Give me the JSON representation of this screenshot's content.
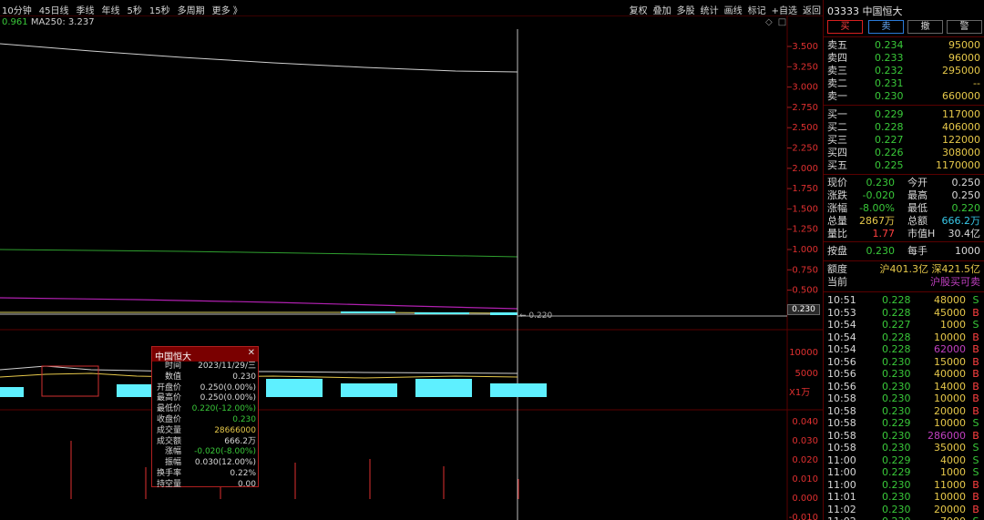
{
  "toolbar": {
    "left": [
      "10分钟",
      "45日线",
      "季线",
      "年线",
      "5秒",
      "15秒",
      "多周期",
      "更多 》"
    ],
    "right": [
      "复权",
      "叠加",
      "多股",
      "统计",
      "画线",
      "标记",
      "+自选",
      "返回"
    ]
  },
  "ma": {
    "prefix": "0.961",
    "label": "MA250: 3.237"
  },
  "corner_icons": {
    "diamond": "◇",
    "square": "□"
  },
  "price_axis": [
    "3.500",
    "3.250",
    "3.000",
    "2.750",
    "2.500",
    "2.250",
    "2.000",
    "1.750",
    "1.500",
    "1.250",
    "1.000",
    "0.750",
    "0.500"
  ],
  "current_price_box": "0.230",
  "crosshair_label": "← 0.220",
  "volume_axis": [
    "10000",
    "5000"
  ],
  "volume_unit": "X1万",
  "indicator_axis": [
    "0.040",
    "0.030",
    "0.020",
    "0.010",
    "0.000",
    "-0.010"
  ],
  "tooltip": {
    "title": "中国恒大",
    "close": "✕",
    "rows": [
      {
        "k": "时间",
        "v": "2023/11/29/三",
        "c": "#d8d8d8"
      },
      {
        "k": "数值",
        "v": "0.230",
        "c": "#d8d8d8"
      },
      {
        "k": "开盘价",
        "v": "0.250(0.00%)",
        "c": "#d8d8d8"
      },
      {
        "k": "最高价",
        "v": "0.250(0.00%)",
        "c": "#d8d8d8"
      },
      {
        "k": "最低价",
        "v": "0.220(-12.00%)",
        "c": "#39c839"
      },
      {
        "k": "收盘价",
        "v": "0.230",
        "c": "#39c839"
      },
      {
        "k": "成交量",
        "v": "28666000",
        "c": "#e6c84a"
      },
      {
        "k": "成交额",
        "v": "666.2万",
        "c": "#d8d8d8"
      },
      {
        "k": "涨幅",
        "v": "-0.020(-8.00%)",
        "c": "#39c839"
      },
      {
        "k": "振幅",
        "v": "0.030(12.00%)",
        "c": "#d8d8d8"
      },
      {
        "k": "换手率",
        "v": "0.22%",
        "c": "#d8d8d8"
      },
      {
        "k": "持空量",
        "v": "0.00",
        "c": "#d8d8d8"
      }
    ]
  },
  "stock": {
    "title": "03333 中国恒大"
  },
  "trade_buttons": {
    "buy": "买",
    "sell": "卖",
    "cancel": "撤",
    "alert": "警"
  },
  "asks": [
    {
      "label": "卖五",
      "price": "0.234",
      "vol": "95000"
    },
    {
      "label": "卖四",
      "price": "0.233",
      "vol": "96000"
    },
    {
      "label": "卖三",
      "price": "0.232",
      "vol": "295000"
    },
    {
      "label": "卖二",
      "price": "0.231",
      "vol": "--"
    },
    {
      "label": "卖一",
      "price": "0.230",
      "vol": "660000"
    }
  ],
  "bids": [
    {
      "label": "买一",
      "price": "0.229",
      "vol": "117000"
    },
    {
      "label": "买二",
      "price": "0.228",
      "vol": "406000"
    },
    {
      "label": "买三",
      "price": "0.227",
      "vol": "122000"
    },
    {
      "label": "买四",
      "price": "0.226",
      "vol": "308000"
    },
    {
      "label": "买五",
      "price": "0.225",
      "vol": "1170000"
    }
  ],
  "quote": [
    {
      "l1": "现价",
      "v1": "0.230",
      "c1": "#39c839",
      "l2": "今开",
      "v2": "0.250",
      "c2": "#d8d8d8"
    },
    {
      "l1": "涨跌",
      "v1": "-0.020",
      "c1": "#39c839",
      "l2": "最高",
      "v2": "0.250",
      "c2": "#d8d8d8"
    },
    {
      "l1": "涨幅",
      "v1": "-8.00%",
      "c1": "#39c839",
      "l2": "最低",
      "v2": "0.220",
      "c2": "#39c839"
    },
    {
      "l1": "总量",
      "v1": "2867万",
      "c1": "#e6c84a",
      "l2": "总额",
      "v2": "666.2万",
      "c2": "#38c8e8"
    },
    {
      "l1": "量比",
      "v1": "1.77",
      "c1": "#ff4040",
      "l2": "市值H",
      "v2": "30.4亿",
      "c2": "#d8d8d8"
    }
  ],
  "after_hours": {
    "l1": "按盘",
    "v1": "0.230",
    "l2": "每手",
    "v2": "1000"
  },
  "quota": {
    "label": "额度",
    "value": "沪401.3亿 深421.5亿",
    "label2": "当前",
    "value2": "沪股买可卖"
  },
  "trades": [
    {
      "t": "10:51",
      "p": "0.228",
      "v": "48000",
      "s": "S",
      "vc": "#e6c84a"
    },
    {
      "t": "10:53",
      "p": "0.228",
      "v": "45000",
      "s": "B",
      "vc": "#e6c84a"
    },
    {
      "t": "10:54",
      "p": "0.227",
      "v": "1000",
      "s": "S",
      "vc": "#e6c84a"
    },
    {
      "t": "10:54",
      "p": "0.228",
      "v": "10000",
      "s": "B",
      "vc": "#e6c84a"
    },
    {
      "t": "10:54",
      "p": "0.228",
      "v": "62000",
      "s": "B",
      "vc": "#c040c0"
    },
    {
      "t": "10:56",
      "p": "0.230",
      "v": "15000",
      "s": "B",
      "vc": "#e6c84a"
    },
    {
      "t": "10:56",
      "p": "0.230",
      "v": "40000",
      "s": "B",
      "vc": "#e6c84a"
    },
    {
      "t": "10:56",
      "p": "0.230",
      "v": "14000",
      "s": "B",
      "vc": "#e6c84a"
    },
    {
      "t": "10:58",
      "p": "0.230",
      "v": "10000",
      "s": "B",
      "vc": "#e6c84a"
    },
    {
      "t": "10:58",
      "p": "0.230",
      "v": "20000",
      "s": "B",
      "vc": "#e6c84a"
    },
    {
      "t": "10:58",
      "p": "0.229",
      "v": "10000",
      "s": "S",
      "vc": "#e6c84a"
    },
    {
      "t": "10:58",
      "p": "0.230",
      "v": "286000",
      "s": "B",
      "vc": "#c040c0"
    },
    {
      "t": "10:58",
      "p": "0.230",
      "v": "35000",
      "s": "S",
      "vc": "#e6c84a"
    },
    {
      "t": "11:00",
      "p": "0.229",
      "v": "4000",
      "s": "S",
      "vc": "#e6c84a"
    },
    {
      "t": "11:00",
      "p": "0.229",
      "v": "1000",
      "s": "S",
      "vc": "#e6c84a"
    },
    {
      "t": "11:00",
      "p": "0.230",
      "v": "11000",
      "s": "B",
      "vc": "#e6c84a"
    },
    {
      "t": "11:01",
      "p": "0.230",
      "v": "10000",
      "s": "B",
      "vc": "#e6c84a"
    },
    {
      "t": "11:02",
      "p": "0.230",
      "v": "20000",
      "s": "B",
      "vc": "#e6c84a"
    },
    {
      "t": "11:02",
      "p": "0.230",
      "v": "7000",
      "s": "S",
      "vc": "#e6c84a"
    }
  ],
  "colors": {
    "up": "#ff4040",
    "down": "#39c839",
    "volume": "#e6c84a",
    "vol_bar": "#5ef0ff",
    "border": "#5a0000",
    "ma": "#39c839"
  }
}
